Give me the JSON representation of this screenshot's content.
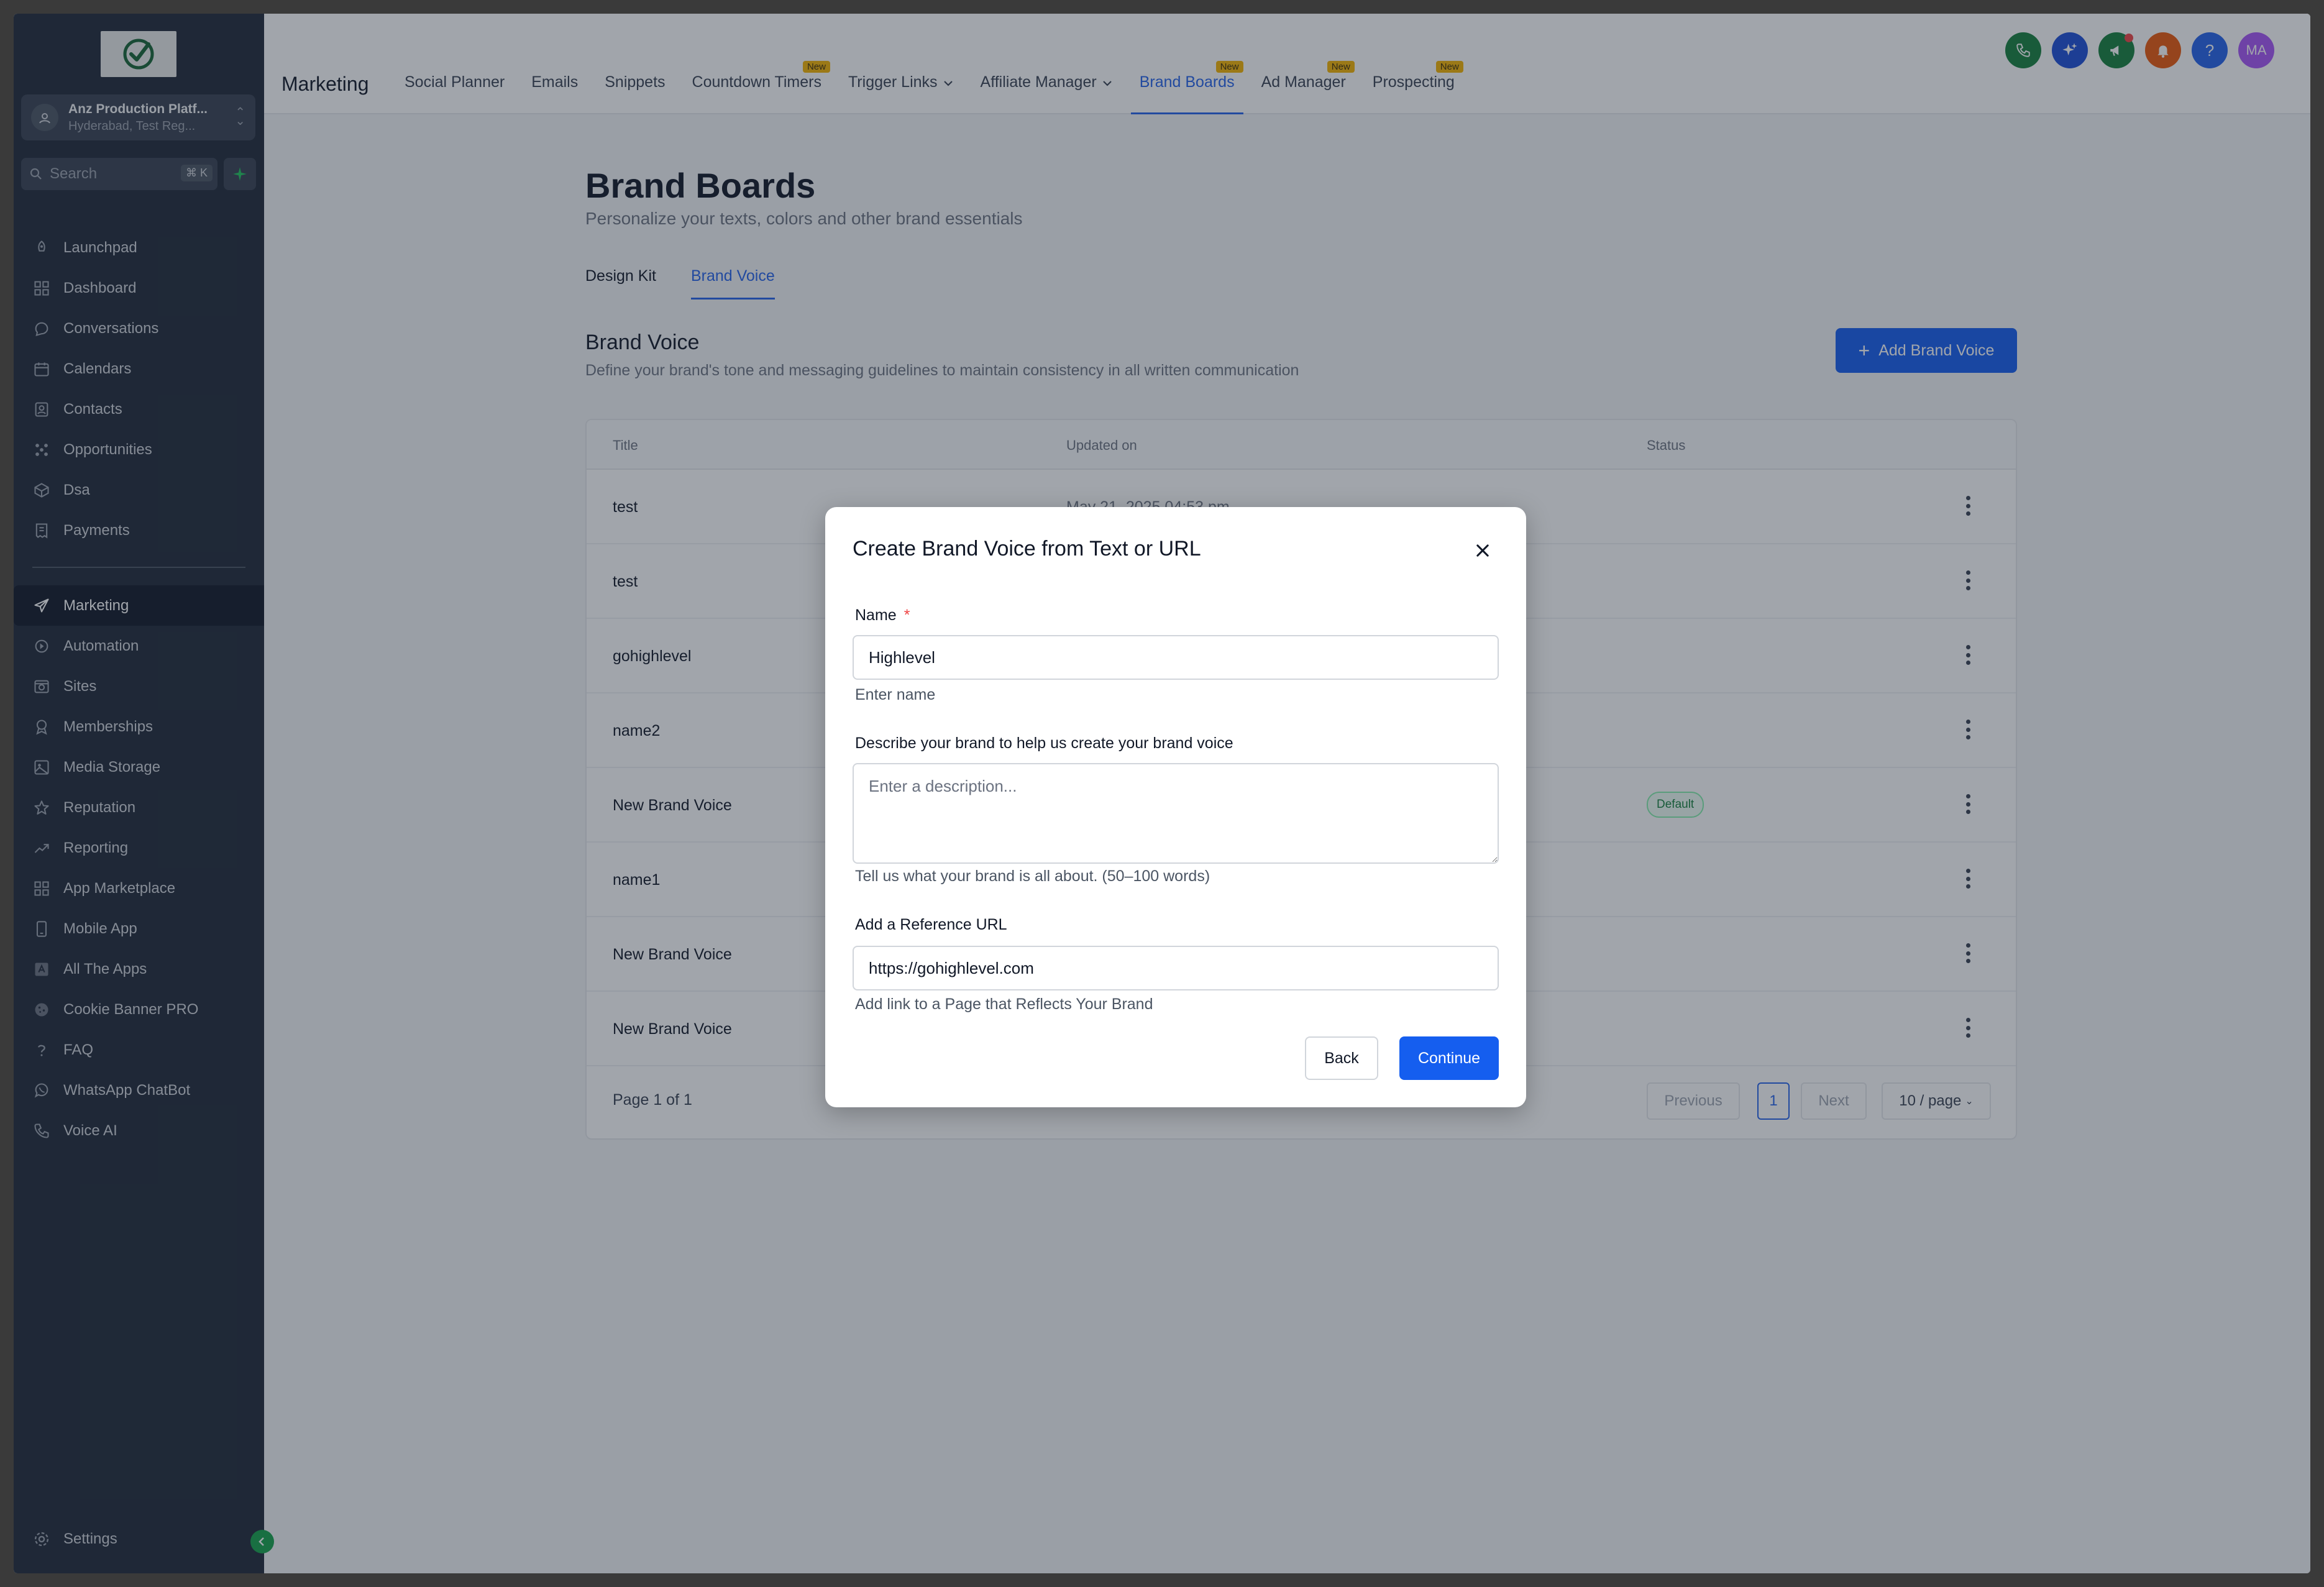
{
  "sidebar": {
    "account_name": "Anz Production Platf...",
    "account_location": "Hyderabad, Test Reg...",
    "search_placeholder": "Search",
    "search_shortcut": "⌘ K",
    "items_top": [
      {
        "label": "Launchpad",
        "icon": "rocket-icon"
      },
      {
        "label": "Dashboard",
        "icon": "grid-icon"
      },
      {
        "label": "Conversations",
        "icon": "chat-icon"
      },
      {
        "label": "Calendars",
        "icon": "calendar-icon"
      },
      {
        "label": "Contacts",
        "icon": "contacts-icon"
      },
      {
        "label": "Opportunities",
        "icon": "opportunities-icon"
      },
      {
        "label": "Dsa",
        "icon": "box-icon"
      },
      {
        "label": "Payments",
        "icon": "receipt-icon"
      }
    ],
    "items_bottom": [
      {
        "label": "Marketing",
        "icon": "send-icon",
        "active": true
      },
      {
        "label": "Automation",
        "icon": "automation-icon"
      },
      {
        "label": "Sites",
        "icon": "sites-icon"
      },
      {
        "label": "Memberships",
        "icon": "award-icon"
      },
      {
        "label": "Media Storage",
        "icon": "image-icon"
      },
      {
        "label": "Reputation",
        "icon": "star-icon"
      },
      {
        "label": "Reporting",
        "icon": "trend-icon"
      },
      {
        "label": "App Marketplace",
        "icon": "apps-icon"
      },
      {
        "label": "Mobile App",
        "icon": "mobile-icon"
      },
      {
        "label": "All The Apps",
        "icon": "all-apps-icon"
      },
      {
        "label": "Cookie Banner PRO",
        "icon": "cookie-icon"
      },
      {
        "label": "FAQ",
        "icon": "question-icon"
      },
      {
        "label": "WhatsApp ChatBot",
        "icon": "whatsapp-icon"
      },
      {
        "label": "Voice AI",
        "icon": "phone-icon"
      }
    ],
    "settings_label": "Settings"
  },
  "topbar": {
    "section_title": "Marketing",
    "tabs": [
      {
        "label": "Social Planner"
      },
      {
        "label": "Emails"
      },
      {
        "label": "Snippets"
      },
      {
        "label": "Countdown Timers",
        "badge": "New"
      },
      {
        "label": "Trigger Links",
        "dropdown": true
      },
      {
        "label": "Affiliate Manager",
        "dropdown": true
      },
      {
        "label": "Brand Boards",
        "badge": "New",
        "active": true
      },
      {
        "label": "Ad Manager",
        "badge": "New"
      },
      {
        "label": "Prospecting",
        "badge": "New"
      }
    ],
    "avatar_initials": "MA",
    "icon_colors": {
      "phone": "#15803d",
      "ai": "#1d4ed8",
      "megaphone": "#15803d",
      "bell": "#ea580c",
      "help": "#2563eb",
      "avatar": "#a855f7"
    }
  },
  "page": {
    "title": "Brand Boards",
    "subtitle": "Personalize your texts, colors and other brand essentials",
    "subtabs": [
      "Design Kit",
      "Brand Voice"
    ],
    "section_title": "Brand Voice",
    "section_subtitle": "Define your brand's tone and messaging guidelines to maintain consistency in all written communication",
    "add_button": "Add Brand Voice",
    "table": {
      "headers": [
        "Title",
        "Updated on",
        "Status"
      ],
      "rows": [
        {
          "title": "test",
          "updated": "May 21, 2025 04:53 pm",
          "status": ""
        },
        {
          "title": "test",
          "updated": "",
          "status": ""
        },
        {
          "title": "gohighlevel",
          "updated": "",
          "status": ""
        },
        {
          "title": "name2",
          "updated": "",
          "status": ""
        },
        {
          "title": "New Brand Voice",
          "updated": "",
          "status": "Default"
        },
        {
          "title": "name1",
          "updated": "",
          "status": ""
        },
        {
          "title": "New Brand Voice",
          "updated": "",
          "status": ""
        },
        {
          "title": "New Brand Voice",
          "updated": "",
          "status": ""
        }
      ],
      "page_info": "Page 1 of 1",
      "prev": "Previous",
      "current_page": "1",
      "next": "Next",
      "per_page": "10 / page"
    }
  },
  "modal": {
    "title": "Create Brand Voice from Text or URL",
    "name_label": "Name",
    "required_mark": "*",
    "name_value": "Highlevel",
    "name_hint": "Enter name",
    "desc_label": "Describe your brand to help us create your brand voice",
    "desc_placeholder": "Enter a description...",
    "desc_hint": "Tell us what your brand is all about. (50–100 words)",
    "url_label": "Add a Reference URL",
    "url_value": "https://gohighlevel.com",
    "url_hint": "Add link to a Page that Reflects Your Brand",
    "back": "Back",
    "continue": "Continue"
  }
}
